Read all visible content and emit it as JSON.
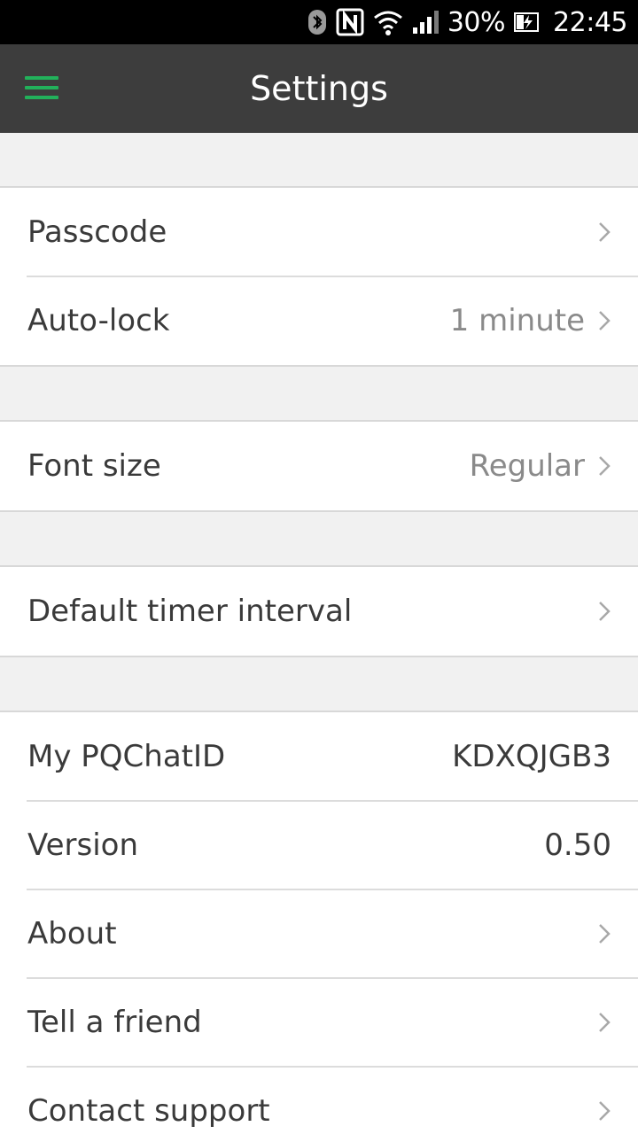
{
  "status_bar": {
    "battery_percent": "30%",
    "time": "22:45",
    "icons": [
      "bluetooth-icon",
      "nfc-icon",
      "wifi-icon",
      "signal-icon",
      "battery-charging-icon"
    ]
  },
  "app_bar": {
    "title": "Settings",
    "menu_icon": "hamburger-menu-icon",
    "accent_color": "#22b15b",
    "background_color": "#3d3d3d"
  },
  "settings": {
    "passcode": {
      "label": "Passcode"
    },
    "auto_lock": {
      "label": "Auto-lock",
      "value": "1 minute"
    },
    "font_size": {
      "label": "Font size",
      "value": "Regular"
    },
    "default_timer_interval": {
      "label": "Default timer interval"
    },
    "my_pqchatid": {
      "label": "My PQChatID",
      "value": "KDXQJGB3"
    },
    "version": {
      "label": "Version",
      "value": "0.50"
    },
    "about": {
      "label": "About"
    },
    "tell_a_friend": {
      "label": "Tell a friend"
    },
    "contact_support": {
      "label": "Contact support"
    }
  }
}
